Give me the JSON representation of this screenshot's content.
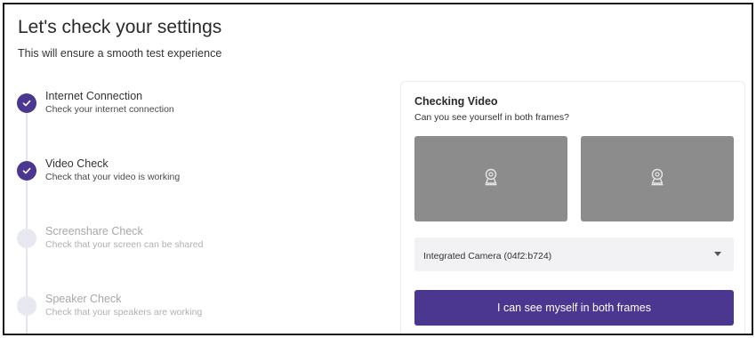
{
  "header": {
    "title": "Let's check your settings",
    "subtitle": "This will ensure a smooth test experience"
  },
  "steps": [
    {
      "title": "Internet Connection",
      "description": "Check your internet connection",
      "status": "complete"
    },
    {
      "title": "Video Check",
      "description": "Check that your video is working",
      "status": "complete"
    },
    {
      "title": "Screenshare Check",
      "description": "Check that your screen can be shared",
      "status": "pending"
    },
    {
      "title": "Speaker Check",
      "description": "Check that your speakers are working",
      "status": "pending"
    }
  ],
  "video_card": {
    "title": "Checking Video",
    "question": "Can you see yourself in both frames?",
    "frame_icon": "webcam-icon",
    "camera_select": {
      "value": "Integrated Camera (04f2:b724)"
    },
    "confirm_label": "I can see myself in both frames"
  },
  "colors": {
    "accent": "#4b3690",
    "frame_placeholder": "#8c8c8c",
    "pending_marker": "#e8e8f0"
  }
}
